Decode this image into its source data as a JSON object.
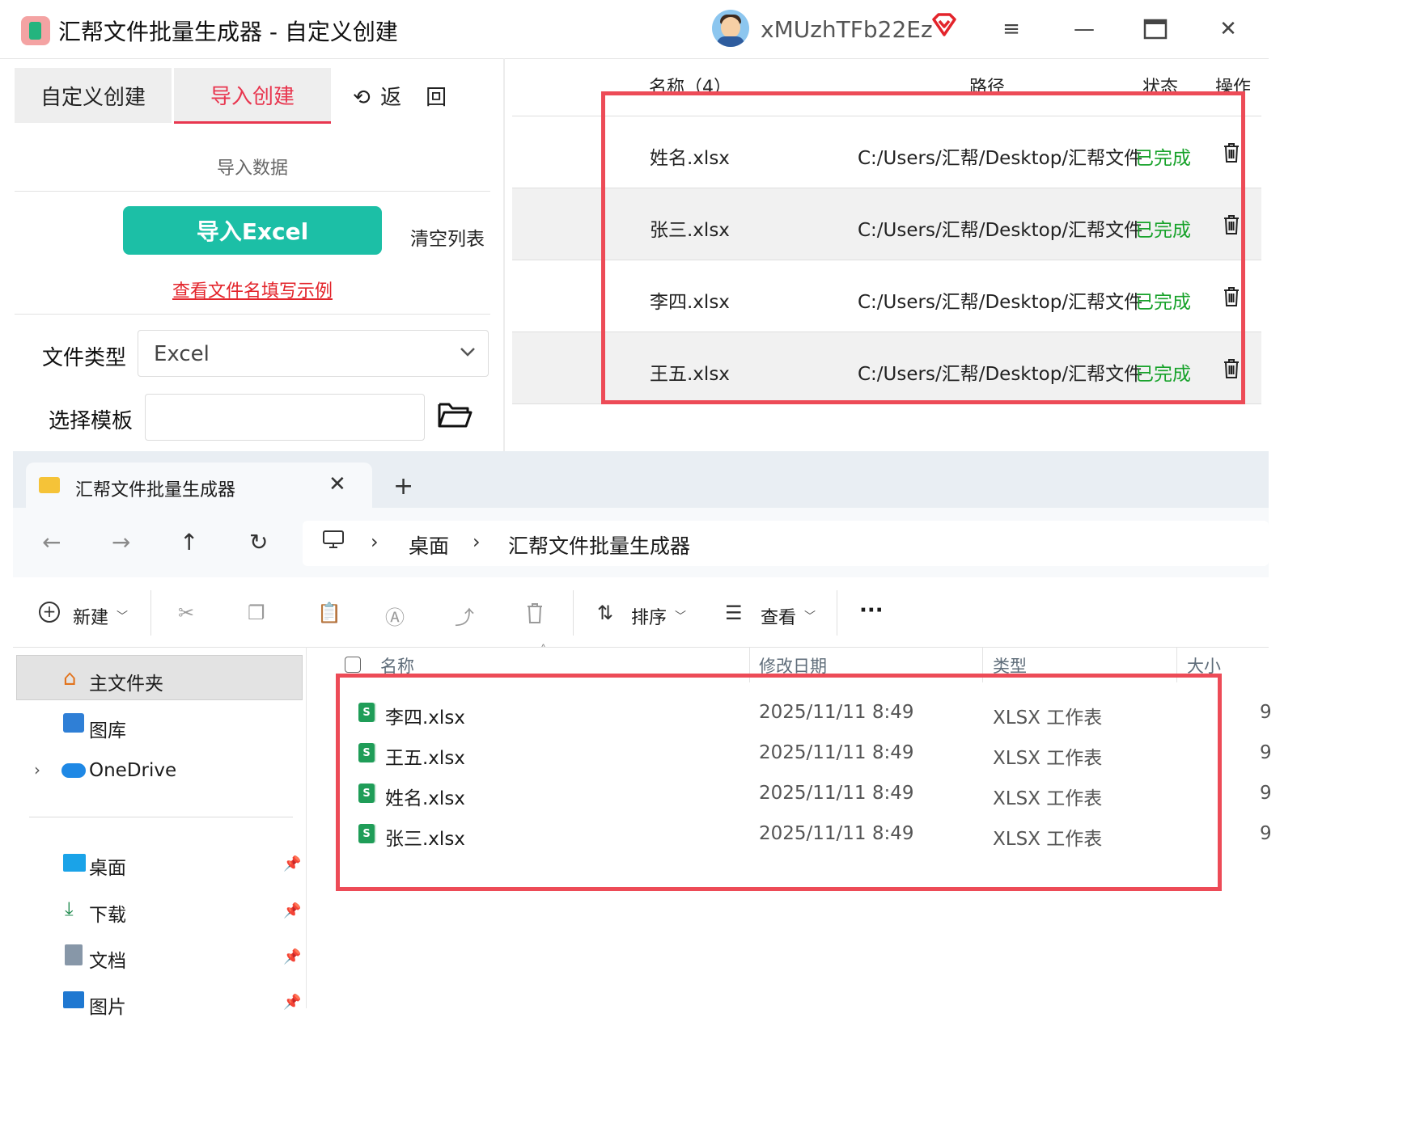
{
  "app": {
    "title": "汇帮文件批量生成器 - 自定义创建",
    "username": "xMUzhTFb22Ez",
    "window_buttons": [
      "≡",
      "—",
      "□",
      "✕"
    ]
  },
  "left": {
    "tab_custom": "自定义创建",
    "tab_import": "导入创建",
    "back": "返　回",
    "import_data": "导入数据",
    "import_excel": "导入Excel",
    "clear_list": "清空列表",
    "example_link": "查看文件名填写示例",
    "file_type_label": "文件类型",
    "file_type_value": "Excel",
    "template_label": "选择模板",
    "template_value": ""
  },
  "table": {
    "headers": {
      "name": "名称（4）",
      "path": "路径",
      "status": "状态",
      "action": "操作"
    },
    "rows": [
      {
        "name": "姓名.xlsx",
        "path": "C:/Users/汇帮/Desktop/汇帮文件",
        "status": "已完成"
      },
      {
        "name": "张三.xlsx",
        "path": "C:/Users/汇帮/Desktop/汇帮文件",
        "status": "已完成"
      },
      {
        "name": "李四.xlsx",
        "path": "C:/Users/汇帮/Desktop/汇帮文件",
        "status": "已完成"
      },
      {
        "name": "王五.xlsx",
        "path": "C:/Users/汇帮/Desktop/汇帮文件",
        "status": "已完成"
      }
    ]
  },
  "explorer": {
    "tab_title": "汇帮文件批量生成器",
    "breadcrumb": [
      "桌面",
      "汇帮文件批量生成器"
    ],
    "toolbar": {
      "new": "新建",
      "sort": "排序",
      "view": "查看",
      "more": "···"
    },
    "sidebar": {
      "home": "主文件夹",
      "gallery": "图库",
      "onedrive": "OneDrive",
      "desktop": "桌面",
      "downloads": "下载",
      "documents": "文档",
      "pictures": "图片"
    },
    "columns": {
      "name": "名称",
      "modified": "修改日期",
      "type": "类型",
      "size": "大小"
    },
    "files": [
      {
        "name": "李四.xlsx",
        "modified": "2025/11/11 8:49",
        "type": "XLSX 工作表",
        "size_partial": "9"
      },
      {
        "name": "王五.xlsx",
        "modified": "2025/11/11 8:49",
        "type": "XLSX 工作表",
        "size_partial": "9"
      },
      {
        "name": "姓名.xlsx",
        "modified": "2025/11/11 8:49",
        "type": "XLSX 工作表",
        "size_partial": "9"
      },
      {
        "name": "张三.xlsx",
        "modified": "2025/11/11 8:49",
        "type": "XLSX 工作表",
        "size_partial": "9"
      }
    ],
    "xls_badge": "S"
  },
  "colors": {
    "accent_red": "#e8364f",
    "teal_button": "#1cbfa6",
    "status_green": "#17a22a",
    "highlight_box": "#ed4b57"
  }
}
